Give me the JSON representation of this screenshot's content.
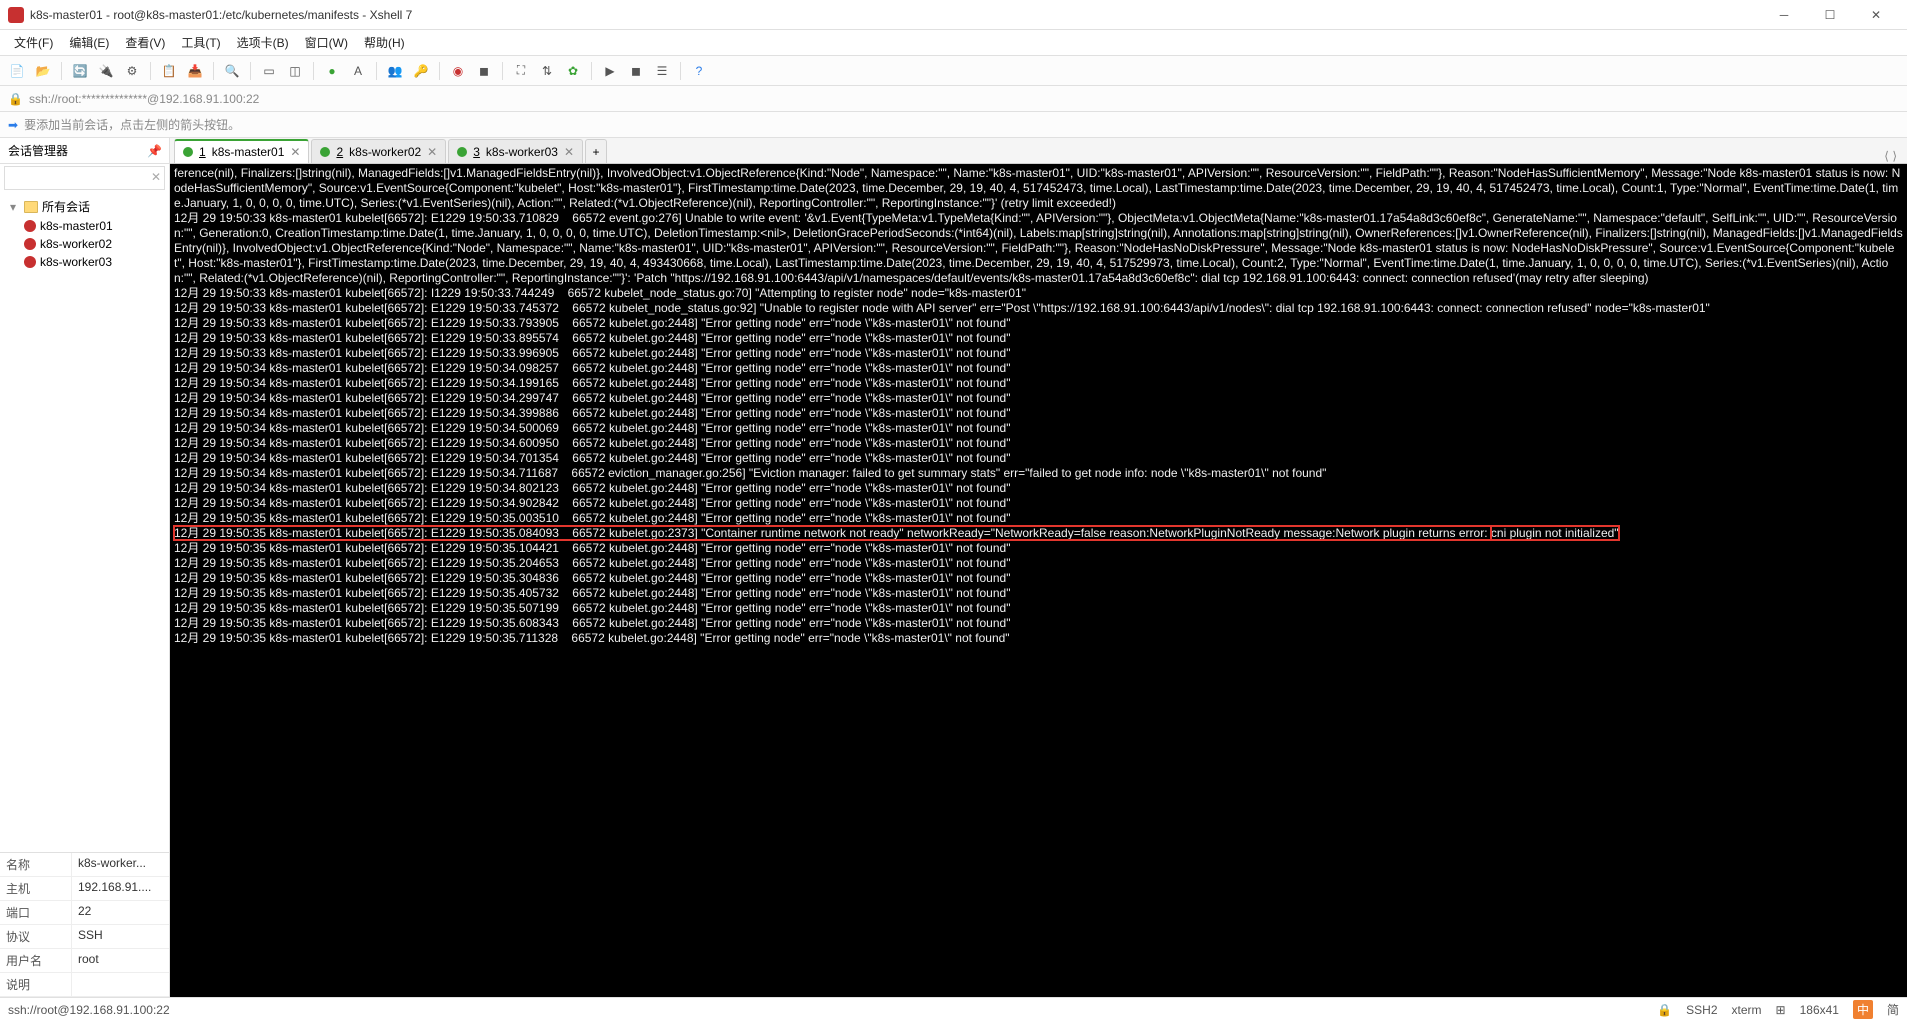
{
  "window": {
    "title": "k8s-master01 - root@k8s-master01:/etc/kubernetes/manifests - Xshell 7"
  },
  "menu": {
    "file": "文件(F)",
    "edit": "编辑(E)",
    "view": "查看(V)",
    "tools": "工具(T)",
    "tab": "选项卡(B)",
    "window": "窗口(W)",
    "help": "帮助(H)"
  },
  "addressbar": {
    "text": "ssh://root:**************@192.168.91.100:22"
  },
  "hint": {
    "text": "要添加当前会话，点击左侧的箭头按钮。"
  },
  "sidebar": {
    "title": "会话管理器",
    "root": "所有会话",
    "items": [
      {
        "label": "k8s-master01"
      },
      {
        "label": "k8s-worker02"
      },
      {
        "label": "k8s-worker03"
      }
    ],
    "props": {
      "name_k": "名称",
      "name_v": "k8s-worker...",
      "host_k": "主机",
      "host_v": "192.168.91....",
      "port_k": "端口",
      "port_v": "22",
      "proto_k": "协议",
      "proto_v": "SSH",
      "user_k": "用户名",
      "user_v": "root",
      "desc_k": "说明",
      "desc_v": ""
    }
  },
  "tabs": [
    {
      "num": "1",
      "label": "k8s-master01",
      "active": true
    },
    {
      "num": "2",
      "label": "k8s-worker02",
      "active": false
    },
    {
      "num": "3",
      "label": "k8s-worker03",
      "active": false
    }
  ],
  "terminal": {
    "pre1": "ference(nil), Finalizers:[]string(nil), ManagedFields:[]v1.ManagedFieldsEntry(nil)}, InvolvedObject:v1.ObjectReference{Kind:\"Node\", Namespace:\"\", Name:\"k8s-master01\", UID:\"k8s-master01\", APIVersion:\"\", ResourceVersion:\"\", FieldPath:\"\"}, Reason:\"NodeHasSufficientMemory\", Message:\"Node k8s-master01 status is now: NodeHasSufficientMemory\", Source:v1.EventSource{Component:\"kubelet\", Host:\"k8s-master01\"}, FirstTimestamp:time.Date(2023, time.December, 29, 19, 40, 4, 517452473, time.Local), LastTimestamp:time.Date(2023, time.December, 29, 19, 40, 4, 517452473, time.Local), Count:1, Type:\"Normal\", EventTime:time.Date(1, time.January, 1, 0, 0, 0, 0, time.UTC), Series:(*v1.EventSeries)(nil), Action:\"\", Related:(*v1.ObjectReference)(nil), ReportingController:\"\", ReportingInstance:\"\"}' (retry limit exceeded!)\n12月 29 19:50:33 k8s-master01 kubelet[66572]: E1229 19:50:33.710829    66572 event.go:276] Unable to write event: '&v1.Event{TypeMeta:v1.TypeMeta{Kind:\"\", APIVersion:\"\"}, ObjectMeta:v1.ObjectMeta{Name:\"k8s-master01.17a54a8d3c60ef8c\", GenerateName:\"\", Namespace:\"default\", SelfLink:\"\", UID:\"\", ResourceVersion:\"\", Generation:0, CreationTimestamp:time.Date(1, time.January, 1, 0, 0, 0, 0, time.UTC), DeletionTimestamp:<nil>, DeletionGracePeriodSeconds:(*int64)(nil), Labels:map[string]string(nil), Annotations:map[string]string(nil), OwnerReferences:[]v1.OwnerReference(nil), Finalizers:[]string(nil), ManagedFields:[]v1.ManagedFieldsEntry(nil)}, InvolvedObject:v1.ObjectReference{Kind:\"Node\", Namespace:\"\", Name:\"k8s-master01\", UID:\"k8s-master01\", APIVersion:\"\", ResourceVersion:\"\", FieldPath:\"\"}, Reason:\"NodeHasNoDiskPressure\", Message:\"Node k8s-master01 status is now: NodeHasNoDiskPressure\", Source:v1.EventSource{Component:\"kubelet\", Host:\"k8s-master01\"}, FirstTimestamp:time.Date(2023, time.December, 29, 19, 40, 4, 493430668, time.Local), LastTimestamp:time.Date(2023, time.December, 29, 19, 40, 4, 517529973, time.Local), Count:2, Type:\"Normal\", EventTime:time.Date(1, time.January, 1, 0, 0, 0, 0, time.UTC), Series:(*v1.EventSeries)(nil), Action:\"\", Related:(*v1.ObjectReference)(nil), ReportingController:\"\", ReportingInstance:\"\"}': 'Patch \"https://192.168.91.100:6443/api/v1/namespaces/default/events/k8s-master01.17a54a8d3c60ef8c\": dial tcp 192.168.91.100:6443: connect: connection refused'(may retry after sleeping)\n12月 29 19:50:33 k8s-master01 kubelet[66572]: I1229 19:50:33.744249    66572 kubelet_node_status.go:70] \"Attempting to register node\" node=\"k8s-master01\"\n12月 29 19:50:33 k8s-master01 kubelet[66572]: E1229 19:50:33.745372    66572 kubelet_node_status.go:92] \"Unable to register node with API server\" err=\"Post \\\"https://192.168.91.100:6443/api/v1/nodes\\\": dial tcp 192.168.91.100:6443: connect: connection refused\" node=\"k8s-master01\"\n12月 29 19:50:33 k8s-master01 kubelet[66572]: E1229 19:50:33.793905    66572 kubelet.go:2448] \"Error getting node\" err=\"node \\\"k8s-master01\\\" not found\"\n12月 29 19:50:33 k8s-master01 kubelet[66572]: E1229 19:50:33.895574    66572 kubelet.go:2448] \"Error getting node\" err=\"node \\\"k8s-master01\\\" not found\"\n12月 29 19:50:33 k8s-master01 kubelet[66572]: E1229 19:50:33.996905    66572 kubelet.go:2448] \"Error getting node\" err=\"node \\\"k8s-master01\\\" not found\"\n12月 29 19:50:34 k8s-master01 kubelet[66572]: E1229 19:50:34.098257    66572 kubelet.go:2448] \"Error getting node\" err=\"node \\\"k8s-master01\\\" not found\"\n12月 29 19:50:34 k8s-master01 kubelet[66572]: E1229 19:50:34.199165    66572 kubelet.go:2448] \"Error getting node\" err=\"node \\\"k8s-master01\\\" not found\"\n12月 29 19:50:34 k8s-master01 kubelet[66572]: E1229 19:50:34.299747    66572 kubelet.go:2448] \"Error getting node\" err=\"node \\\"k8s-master01\\\" not found\"\n12月 29 19:50:34 k8s-master01 kubelet[66572]: E1229 19:50:34.399886    66572 kubelet.go:2448] \"Error getting node\" err=\"node \\\"k8s-master01\\\" not found\"\n12月 29 19:50:34 k8s-master01 kubelet[66572]: E1229 19:50:34.500069    66572 kubelet.go:2448] \"Error getting node\" err=\"node \\\"k8s-master01\\\" not found\"\n12月 29 19:50:34 k8s-master01 kubelet[66572]: E1229 19:50:34.600950    66572 kubelet.go:2448] \"Error getting node\" err=\"node \\\"k8s-master01\\\" not found\"\n12月 29 19:50:34 k8s-master01 kubelet[66572]: E1229 19:50:34.701354    66572 kubelet.go:2448] \"Error getting node\" err=\"node \\\"k8s-master01\\\" not found\"\n12月 29 19:50:34 k8s-master01 kubelet[66572]: E1229 19:50:34.711687    66572 eviction_manager.go:256] \"Eviction manager: failed to get summary stats\" err=\"failed to get node info: node \\\"k8s-master01\\\" not found\"\n12月 29 19:50:34 k8s-master01 kubelet[66572]: E1229 19:50:34.802123    66572 kubelet.go:2448] \"Error getting node\" err=\"node \\\"k8s-master01\\\" not found\"\n12月 29 19:50:34 k8s-master01 kubelet[66572]: E1229 19:50:34.902842    66572 kubelet.go:2448] \"Error getting node\" err=\"node \\\"k8s-master01\\\" not found\"\n12月 29 19:50:35 k8s-master01 kubelet[66572]: E1229 19:50:35.003510    66572 kubelet.go:2448] \"Error getting node\" err=\"node \\\"k8s-master01\\\" not found\"",
    "hl1": "12月 29 19:50:35 k8s-master01 kubelet[66572]: E1229 19:50:35.084093    66572 kubelet.go:2373] \"Container runtime network not ready\" networkReady=\"NetworkReady=false reason:NetworkPluginNotReady message:Network plugin returns error: ",
    "hl2": "cni plugin not initialized\"",
    "post": "12月 29 19:50:35 k8s-master01 kubelet[66572]: E1229 19:50:35.104421    66572 kubelet.go:2448] \"Error getting node\" err=\"node \\\"k8s-master01\\\" not found\"\n12月 29 19:50:35 k8s-master01 kubelet[66572]: E1229 19:50:35.204653    66572 kubelet.go:2448] \"Error getting node\" err=\"node \\\"k8s-master01\\\" not found\"\n12月 29 19:50:35 k8s-master01 kubelet[66572]: E1229 19:50:35.304836    66572 kubelet.go:2448] \"Error getting node\" err=\"node \\\"k8s-master01\\\" not found\"\n12月 29 19:50:35 k8s-master01 kubelet[66572]: E1229 19:50:35.405732    66572 kubelet.go:2448] \"Error getting node\" err=\"node \\\"k8s-master01\\\" not found\"\n12月 29 19:50:35 k8s-master01 kubelet[66572]: E1229 19:50:35.507199    66572 kubelet.go:2448] \"Error getting node\" err=\"node \\\"k8s-master01\\\" not found\"\n12月 29 19:50:35 k8s-master01 kubelet[66572]: E1229 19:50:35.608343    66572 kubelet.go:2448] \"Error getting node\" err=\"node \\\"k8s-master01\\\" not found\"\n12月 29 19:50:35 k8s-master01 kubelet[66572]: E1229 19:50:35.711328    66572 kubelet.go:2448] \"Error getting node\" err=\"node \\\"k8s-master01\\\" not found\""
  },
  "status": {
    "conn": "ssh://root@192.168.91.100:22",
    "ssh": "SSH2",
    "term": "xterm",
    "size": "186x41",
    "enc": "中",
    "ime": "简"
  }
}
